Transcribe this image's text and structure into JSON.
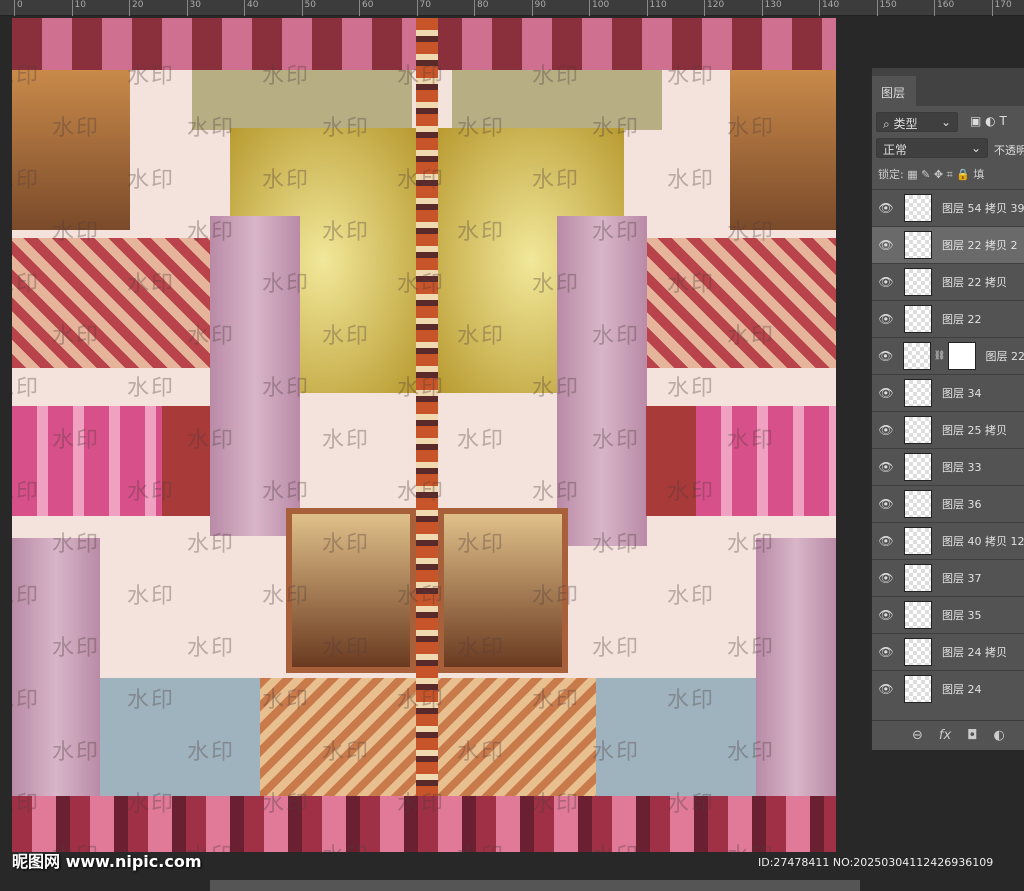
{
  "ruler": {
    "labels": [
      "0",
      "10",
      "20",
      "30",
      "40",
      "50",
      "60",
      "70",
      "80",
      "90",
      "100",
      "110",
      "120",
      "130",
      "140",
      "150",
      "160",
      "170"
    ]
  },
  "canvas": {
    "watermark_text": "水印",
    "colors": {
      "pink": "#c9a0b8",
      "yellow": "#d8c15a",
      "red": "#b83a4a",
      "blue": "#9fb3bf",
      "brown": "#8a4a2c",
      "cream": "#f3e3dc"
    }
  },
  "layers_panel": {
    "tab": "图层",
    "filter": {
      "icon": "search-icon",
      "value": "类型"
    },
    "blend_mode": "正常",
    "opacity_label": "不透明",
    "lock_label": "锁定:",
    "fill_label": "填",
    "layers": [
      {
        "name": "图层 54 拷贝 39",
        "selected": false
      },
      {
        "name": "图层 22 拷贝 2",
        "selected": true
      },
      {
        "name": "图层 22 拷贝",
        "selected": false
      },
      {
        "name": "图层 22",
        "selected": false
      },
      {
        "name": "图层 22",
        "selected": false,
        "mask": true
      },
      {
        "name": "图层 34",
        "selected": false
      },
      {
        "name": "图层 25 拷贝",
        "selected": false
      },
      {
        "name": "图层 33",
        "selected": false
      },
      {
        "name": "图层 36",
        "selected": false
      },
      {
        "name": "图层 40 拷贝 12",
        "selected": false
      },
      {
        "name": "图层 37",
        "selected": false
      },
      {
        "name": "图层 35",
        "selected": false
      },
      {
        "name": "图层 24 拷贝",
        "selected": false
      },
      {
        "name": "图层 24",
        "selected": false
      }
    ],
    "footer": {
      "fx": "fx"
    }
  },
  "overlay": {
    "site_logo": "昵图网 www.nipic.com",
    "id_text": "ID:27478411 NO:20250304112426936109"
  }
}
